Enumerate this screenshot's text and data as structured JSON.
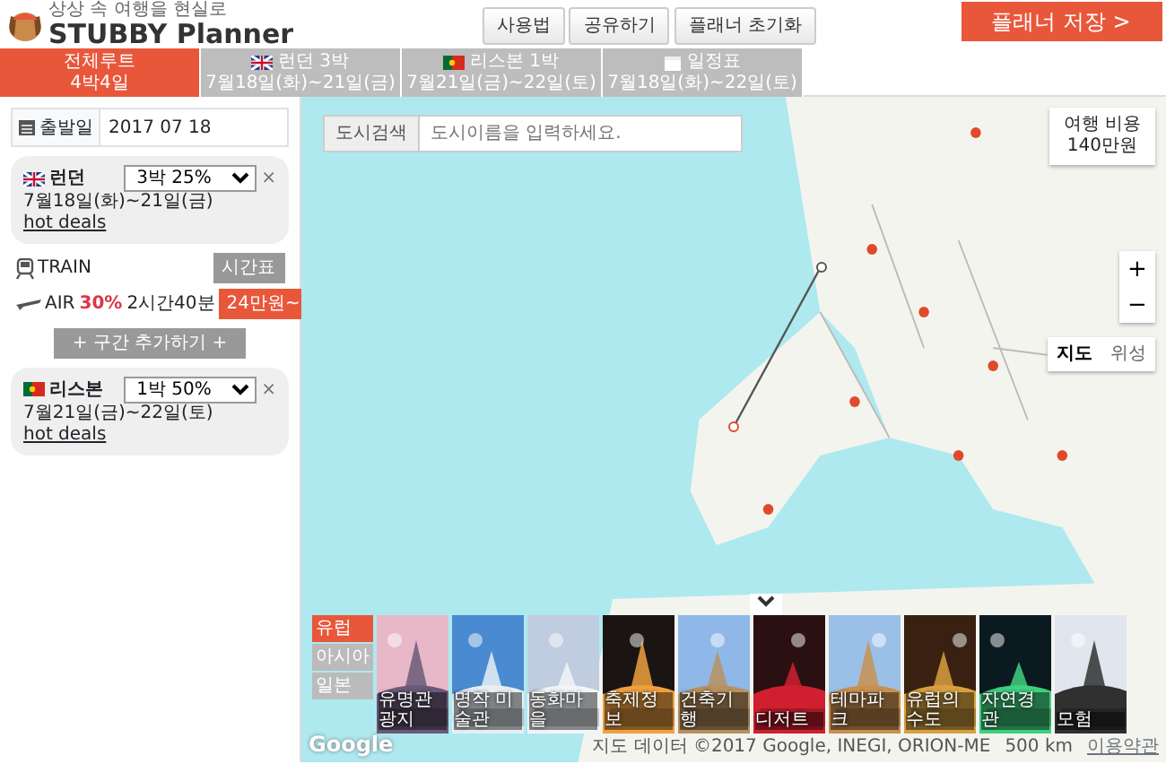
{
  "header": {
    "tagline": "상상 속 여행을 현실로",
    "logo_text": "STUBBY Planner",
    "buttons": [
      "사용법",
      "공유하기",
      "플래너 초기화"
    ],
    "save_button": "플래너 저장 >"
  },
  "tabs": [
    {
      "kind": "overview",
      "title": "전체루트",
      "subtitle": "4박4일",
      "selected": true
    },
    {
      "kind": "flag-uk",
      "title": "런던 3박",
      "subtitle": "7월18일(화)~21일(금)",
      "selected": false
    },
    {
      "kind": "flag-pt",
      "title": "리스본 1박",
      "subtitle": "7월21일(금)~22일(토)",
      "selected": false
    },
    {
      "kind": "schedule",
      "title": "일정표",
      "subtitle": "7월18일(화)~22일(토)",
      "selected": false
    }
  ],
  "sidebar": {
    "departure": {
      "label": "출발일",
      "date": "2017 07 18"
    },
    "route": [
      {
        "kind": "city-uk",
        "name": "런던",
        "stay": "3박 25%",
        "close": "×",
        "dates": "7월18일(화)~21일(금)",
        "link": "hot deals"
      },
      {
        "kind": "train",
        "label": "TRAIN",
        "button": "시간표"
      },
      {
        "kind": "air",
        "label": "AIR",
        "discount": "30%",
        "duration": "2시간40분",
        "button": "24만원~"
      },
      {
        "kind": "add",
        "label": "+ 구간 추가하기 +"
      },
      {
        "kind": "city-pt",
        "name": "리스본",
        "stay": "1박 50%",
        "close": "×",
        "dates": "7월21일(금)~22일(토)",
        "link": "hot deals"
      }
    ]
  },
  "map": {
    "search_label": "도시검색",
    "search_placeholder": "도시이름을 입력하세요.",
    "cost": {
      "label": "여행 비용",
      "value": "140만원"
    },
    "zoom": [
      "+",
      "−"
    ],
    "map_types": [
      {
        "label": "지도",
        "selected": true
      },
      {
        "label": "위성",
        "selected": false
      }
    ],
    "categories": [
      {
        "label": "유럽",
        "selected": true
      },
      {
        "label": "아시아",
        "selected": false
      },
      {
        "label": "일본",
        "selected": false
      }
    ],
    "themes": [
      {
        "label": "유명관광지"
      },
      {
        "label": "명작 미술관"
      },
      {
        "label": "동화마을"
      },
      {
        "label": "축제정보"
      },
      {
        "label": "건축기행"
      },
      {
        "label": "디저트"
      },
      {
        "label": "테마파크"
      },
      {
        "label": "유럽의 수도"
      },
      {
        "label": "자연경관"
      },
      {
        "label": "모험"
      }
    ],
    "google": "Google",
    "attribution": "지도 데이터 ©2017 Google, INEGI, ORION-ME",
    "scale": "500 km",
    "terms": "이용약관"
  }
}
